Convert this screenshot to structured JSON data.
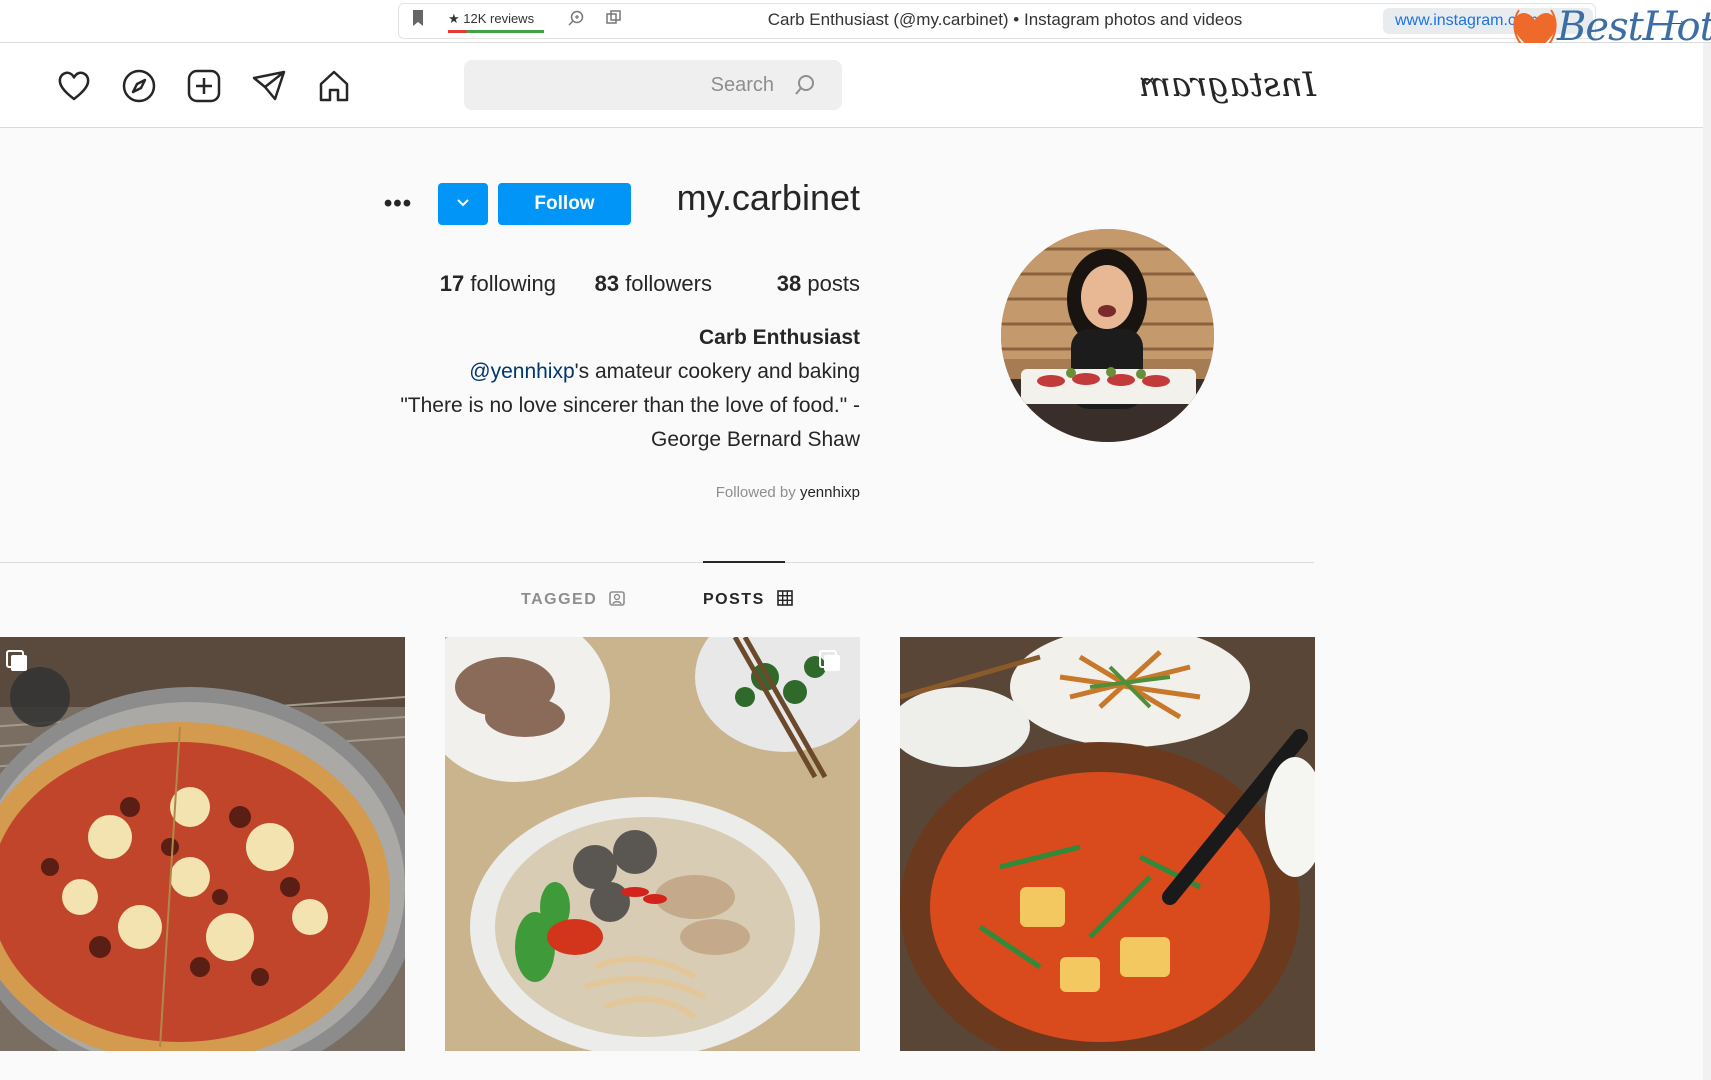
{
  "browser": {
    "tab_title": "Carb Enthusiast (@my.carbinet) • Instagram photos and videos",
    "url": "www.instagram.com",
    "reviews_badge": "★ 12K reviews",
    "watermark_text": "BestHot"
  },
  "header": {
    "logo": "Instagram",
    "search_placeholder": "Search",
    "icons": [
      "home-icon",
      "direct-icon",
      "new-post-icon",
      "explore-icon",
      "activity-icon"
    ]
  },
  "profile": {
    "username": "my.carbinet",
    "follow_label": "Follow",
    "more_label": "•••",
    "posts": "38",
    "posts_label": "posts",
    "followers": "83",
    "followers_label": "followers",
    "following": "17",
    "following_label": "following",
    "full_name": "Carb Enthusiast",
    "bio_mention": "@yennhixp",
    "bio_line1_rest": "'s amateur cookery and baking",
    "bio_line2": "\"There is no love sincerer than the love of food.\" -",
    "bio_line3": "George Bernard Shaw",
    "followed_by_label": "Followed by",
    "followed_by_user": "yennhixp"
  },
  "tabs": {
    "posts_label": "POSTS",
    "tagged_label": "TAGGED",
    "active": "POSTS"
  },
  "posts": [
    {
      "alt": "Kimchi stew in clay pot with stir-fried noodles"
    },
    {
      "alt": "Noodle soup with pork, herbs and chili"
    },
    {
      "alt": "Sausage and cheese pizza on a pan"
    }
  ],
  "colors": {
    "accent": "#0095f6",
    "background": "#fafafa",
    "text": "#262626",
    "muted": "#8e8e8e"
  }
}
